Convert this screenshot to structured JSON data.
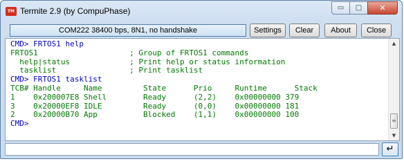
{
  "window": {
    "title": "Termite 2.9 (by CompuPhase)",
    "app_icon_text": "TM",
    "controls": {
      "minimize": "▭",
      "maximize": "□",
      "close": "✕"
    }
  },
  "toolbar": {
    "status": "COM222 38400 bps, 8N1, no handshake",
    "settings_label": "Settings",
    "clear_label": "Clear",
    "about_label": "About",
    "close_label": "Close"
  },
  "terminal": {
    "lines": [
      {
        "text": "CMD> FRTOS1 help",
        "kind": "cmd"
      },
      {
        "text": "FRTOS1                    ; Group of FRTOS1 commands",
        "kind": "out"
      },
      {
        "text": "  help|status             ; Print help or status information",
        "kind": "out"
      },
      {
        "text": "  tasklist                ; Print tasklist",
        "kind": "out"
      },
      {
        "text": "CMD> FRTOS1 tasklist",
        "kind": "cmd"
      },
      {
        "text": "TCB# Handle     Name         State      Prio     Runtime      Stack",
        "kind": "out"
      },
      {
        "text": "1    0x200007E8 Shell        Ready      (2,2)    0x00000000 379",
        "kind": "out"
      },
      {
        "text": "3    0x20000EF8 IDLE         Ready      (0,0)    0x00000000 181",
        "kind": "out"
      },
      {
        "text": "2    0x20000B70 App          Blocked    (1,1)    0x00000000 100",
        "kind": "out"
      },
      {
        "text": "CMD>",
        "kind": "cmd"
      }
    ],
    "scroll_up": "▲",
    "scroll_down": "▼",
    "scroll_thumb": "≡"
  },
  "input": {
    "value": "",
    "enter_symbol": "↵"
  },
  "colors": {
    "command": "#0000c8",
    "output": "#007a00"
  },
  "icons": {
    "app": "termite-app-icon",
    "enter": "enter-return-icon"
  }
}
